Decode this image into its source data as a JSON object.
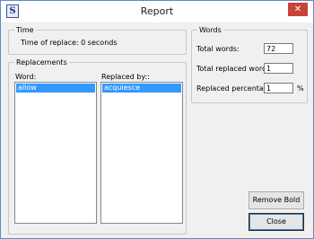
{
  "window": {
    "title": "Report",
    "close_symbol": "✕"
  },
  "time": {
    "group_label": "Time",
    "text": "Time of replace: 0 seconds"
  },
  "replacements": {
    "group_label": "Replacements",
    "word_label": "Word:",
    "replaced_label": "Replaced by::",
    "words": [
      "allow"
    ],
    "replaced_by": [
      "acquiesce"
    ]
  },
  "words": {
    "group_label": "Words",
    "total_words_label": "Total words:",
    "total_words_value": "72",
    "total_replaced_label": "Total replaced words:",
    "total_replaced_value": "1",
    "replaced_pct_label": "Replaced percentage:",
    "replaced_pct_value": "1",
    "pct_unit": "%"
  },
  "buttons": {
    "remove_bold": "Remove Bold",
    "close": "Close"
  },
  "colors": {
    "selection": "#3399ff",
    "close_button": "#c7443a"
  }
}
